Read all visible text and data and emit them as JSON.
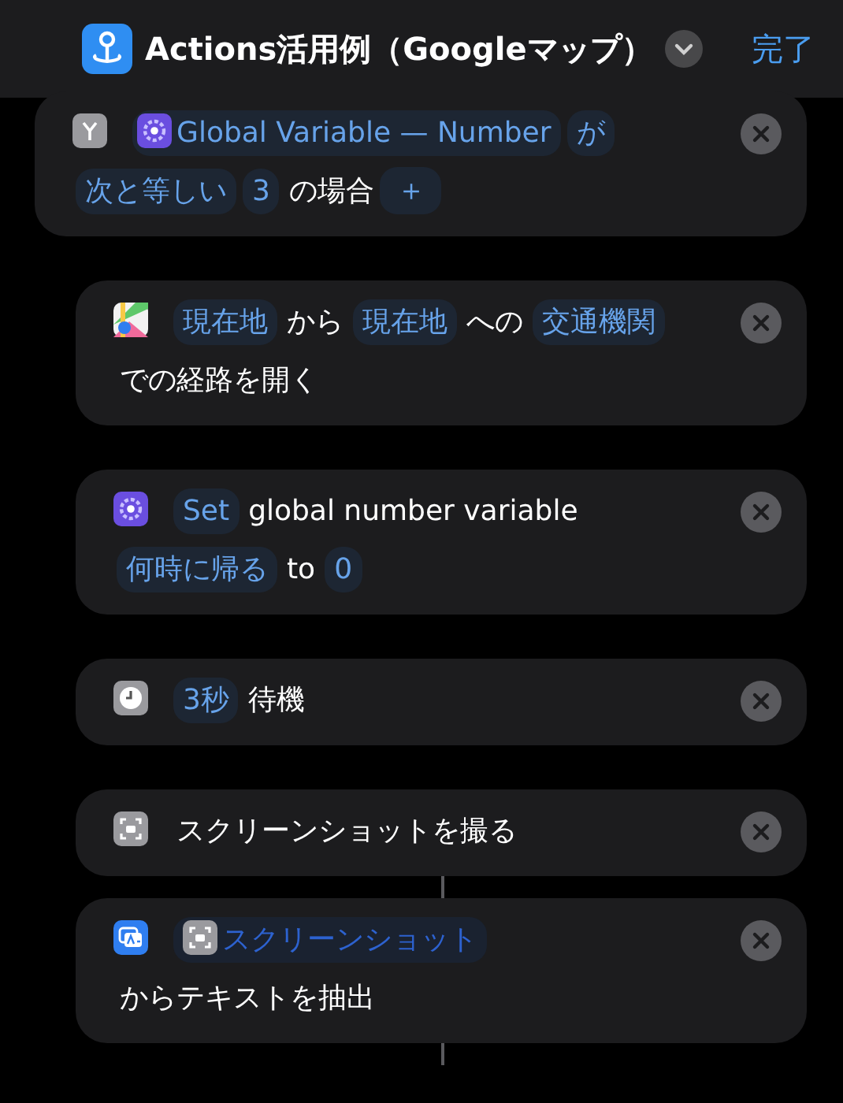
{
  "header": {
    "title": "Actions活用例（Googleマップ）",
    "done": "完了"
  },
  "actions": [
    {
      "kind": "if",
      "linked": false,
      "parts": [
        {
          "kind": "global",
          "text": "Global Variable — Number"
        },
        {
          "kind": "param",
          "text": "が"
        },
        {
          "kind": "param",
          "text": "次と等しい"
        },
        {
          "kind": "param",
          "text": "3"
        },
        {
          "kind": "text",
          "text": "の場合"
        },
        {
          "kind": "add",
          "text": "＋"
        }
      ],
      "children": [
        {
          "kind": "maps",
          "linked": false,
          "parts": [
            {
              "kind": "param",
              "text": "現在地"
            },
            {
              "kind": "text",
              "text": "から"
            },
            {
              "kind": "param",
              "text": "現在地"
            },
            {
              "kind": "text",
              "text": "への"
            },
            {
              "kind": "param",
              "text": "交通機関"
            },
            {
              "kind": "text",
              "text": "での経路を開く"
            }
          ]
        },
        {
          "kind": "variable",
          "linked": false,
          "parts": [
            {
              "kind": "param",
              "text": "Set"
            },
            {
              "kind": "text",
              "text": "global number variable"
            },
            {
              "kind": "param",
              "text": "何時に帰る"
            },
            {
              "kind": "text",
              "text": "to"
            },
            {
              "kind": "param",
              "text": "0"
            }
          ]
        },
        {
          "kind": "clock",
          "linked": false,
          "parts": [
            {
              "kind": "param",
              "text": "3秒"
            },
            {
              "kind": "text",
              "text": "待機"
            }
          ]
        },
        {
          "kind": "screenshot",
          "linked": true,
          "parts": [
            {
              "kind": "text",
              "text": "スクリーンショットを撮る"
            }
          ]
        },
        {
          "kind": "extract",
          "linked": true,
          "parts": [
            {
              "kind": "magic",
              "text": "スクリーンショット"
            },
            {
              "kind": "text",
              "text": "からテキストを抽出"
            }
          ]
        }
      ]
    }
  ]
}
